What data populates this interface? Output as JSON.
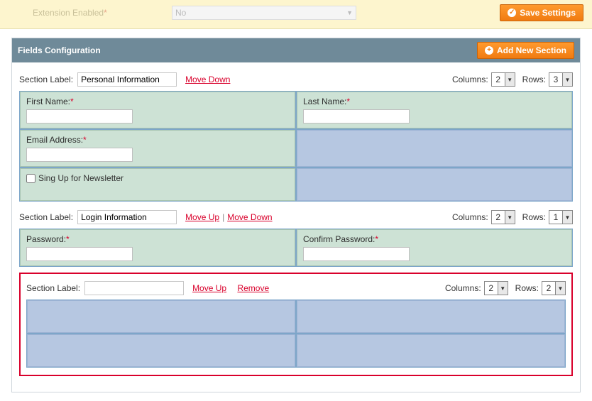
{
  "topbar": {
    "setting_label": "Extension Enabled",
    "setting_required_mark": "*",
    "setting_value": "No",
    "save_button": "Save Settings"
  },
  "panel": {
    "title": "Fields Configuration",
    "add_button": "Add New Section"
  },
  "common": {
    "section_label": "Section Label:",
    "columns_label": "Columns:",
    "rows_label": "Rows:",
    "move_up": "Move Up",
    "move_down": "Move Down",
    "remove": "Remove",
    "separator": "|"
  },
  "sections": [
    {
      "label_value": "Personal Information",
      "actions": [
        "move_down"
      ],
      "columns": "2",
      "rows": "3",
      "highlight": false,
      "cells": [
        {
          "label": "First Name:",
          "required": true,
          "input": "text"
        },
        {
          "label": "Last Name:",
          "required": true,
          "input": "text"
        },
        {
          "label": "Email Address:",
          "required": true,
          "input": "text"
        },
        {
          "empty": true
        },
        {
          "label": "Sing Up for Newsletter",
          "input": "checkbox"
        },
        {
          "empty": true
        }
      ]
    },
    {
      "label_value": "Login Information",
      "actions": [
        "move_up",
        "move_down"
      ],
      "columns": "2",
      "rows": "1",
      "highlight": false,
      "cells": [
        {
          "label": "Password:",
          "required": true,
          "input": "password"
        },
        {
          "label": "Confirm Password:",
          "required": true,
          "input": "password"
        }
      ]
    },
    {
      "label_value": "",
      "actions": [
        "move_up",
        "remove"
      ],
      "columns": "2",
      "rows": "2",
      "highlight": true,
      "cells": [
        {
          "empty": true
        },
        {
          "empty": true
        },
        {
          "empty": true
        },
        {
          "empty": true
        }
      ]
    }
  ]
}
